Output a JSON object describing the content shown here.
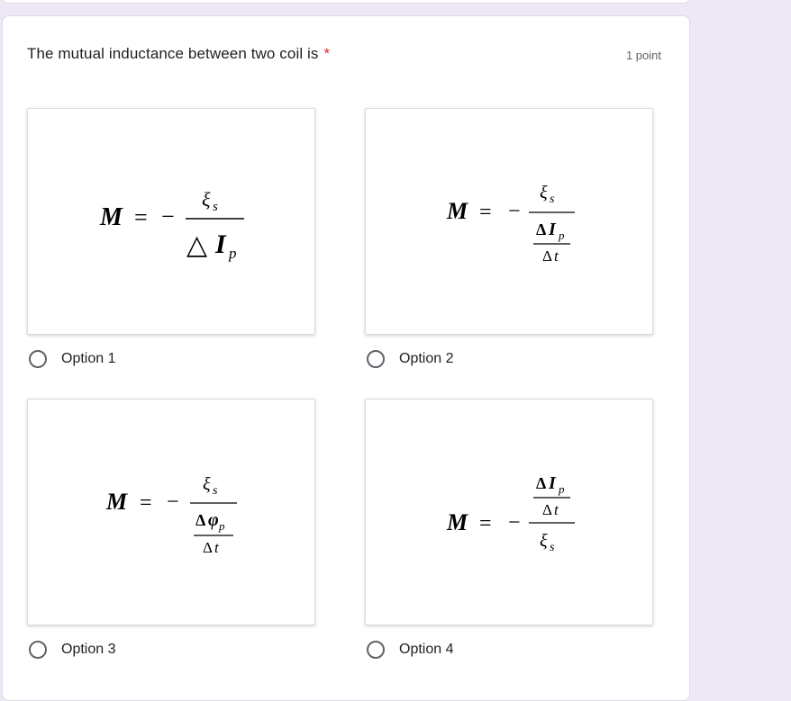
{
  "question": {
    "title": "The mutual inductance between two coil is",
    "required_mark": "*",
    "points": "1 point"
  },
  "options": [
    {
      "label": "Option 1",
      "formula": "M = −ξs / △Ip"
    },
    {
      "label": "Option 2",
      "formula": "M = −ξs / (ΔIp / Δt)"
    },
    {
      "label": "Option 3",
      "formula": "M = −ξs / (Δφp / Δt)"
    },
    {
      "label": "Option 4",
      "formula": "M = −(ΔIp / Δt) / ξs"
    }
  ],
  "colors": {
    "background": "#ede7f6",
    "required": "#d93025",
    "radio_border": "#5f6368"
  }
}
